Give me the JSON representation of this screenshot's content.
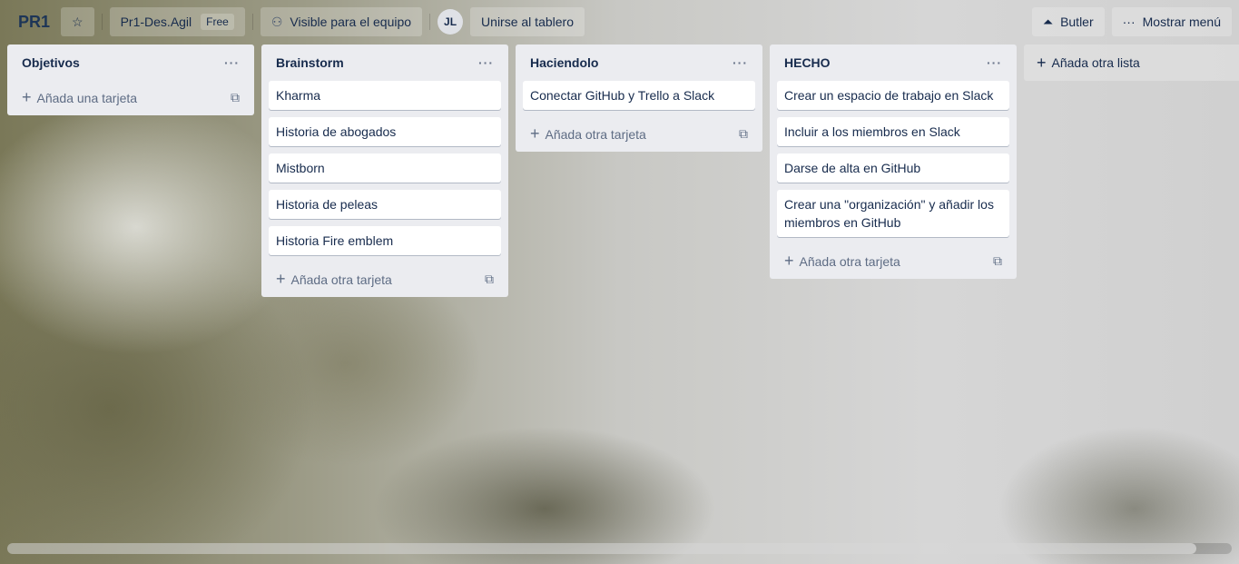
{
  "header": {
    "title": "PR1",
    "workspace": "Pr1-Des.Agil",
    "plan_badge": "Free",
    "visibility": "Visible para el equipo",
    "avatar_initials": "JL",
    "join_label": "Unirse al tablero",
    "butler_label": "Butler",
    "menu_label": "Mostrar menú"
  },
  "lists": [
    {
      "title": "Objetivos",
      "cards": [],
      "add_label": "Añada una tarjeta"
    },
    {
      "title": "Brainstorm",
      "cards": [
        "Kharma",
        "Historia de abogados",
        "Mistborn",
        "Historia de peleas",
        "Historia Fire emblem"
      ],
      "add_label": "Añada otra tarjeta"
    },
    {
      "title": "Haciendolo",
      "cards": [
        "Conectar GitHub y Trello a Slack"
      ],
      "add_label": "Añada otra tarjeta"
    },
    {
      "title": "HECHO",
      "cards": [
        "Crear un espacio de trabajo en Slack",
        "Incluir a los miembros en Slack",
        "Darse de alta en GitHub",
        "Crear una \"organización\" y añadir los miembros en GitHub"
      ],
      "add_label": "Añada otra tarjeta"
    }
  ],
  "add_list_label": "Añada otra lista",
  "icons": {
    "star": "star-icon",
    "visibility": "team-icon",
    "butler": "bell-icon",
    "menu": "more-icon",
    "add": "plus-icon",
    "template": "card-template-icon"
  }
}
